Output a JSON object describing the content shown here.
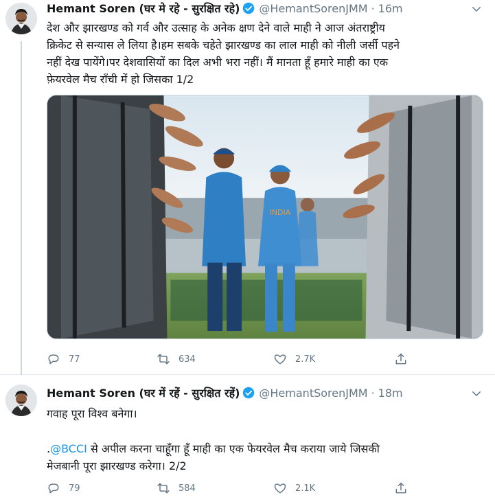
{
  "tweets": [
    {
      "author_name": "Hemant Soren (घर मे रहे - सुरक्षित रहे)",
      "handle": "@HemantSorenJMM",
      "separator": "·",
      "time": "16m",
      "text_lines": [
        "देश और झारखण्ड को गर्व और उत्साह के अनेक क्षण देने वाले माही ने आज अंतराष्ट्रीय",
        "क्रिकेट से सन्यास ले लिया है।हम सबके चहेते झारखण्ड का लाल माही को नीली जर्सी पहने",
        "नहीं देख पायेंगे।पर देशवासियों का दिल अभी भरा नहीं। मैं मानता हूँ हमारे माही का एक",
        "फ़ेयरवेल मैच राँची में हो जिसका 1/2"
      ],
      "reply_count": "77",
      "retweet_count": "634",
      "like_count": "2.7K"
    },
    {
      "author_name": "Hemant Soren (घर में रहें - सुरक्षित रहें)",
      "handle": "@HemantSorenJMM",
      "separator": "·",
      "time": "18m",
      "line1": "गवाह पूरा विश्व बनेगा।",
      "line2_prefix": ".",
      "line2_mention": "@BCCI",
      "line2_rest": " से अपील करना चाहूँगा हूँ माही का एक फेयरवेल मैच कराया जाये जिसकी",
      "line3": "मेजबानी पूरा झारखण्ड करेगा। 2/2",
      "reply_count": "79",
      "retweet_count": "584",
      "like_count": "2.1K"
    }
  ],
  "icons": {
    "verified": "verified-badge-icon",
    "caret": "chevron-down-icon",
    "reply": "reply-icon",
    "retweet": "retweet-icon",
    "like": "heart-icon",
    "share": "share-icon"
  },
  "colors": {
    "link": "#1b95e0",
    "secondary_text": "#657786",
    "verified": "#1da1f2",
    "jersey": "#2f7fc4"
  }
}
